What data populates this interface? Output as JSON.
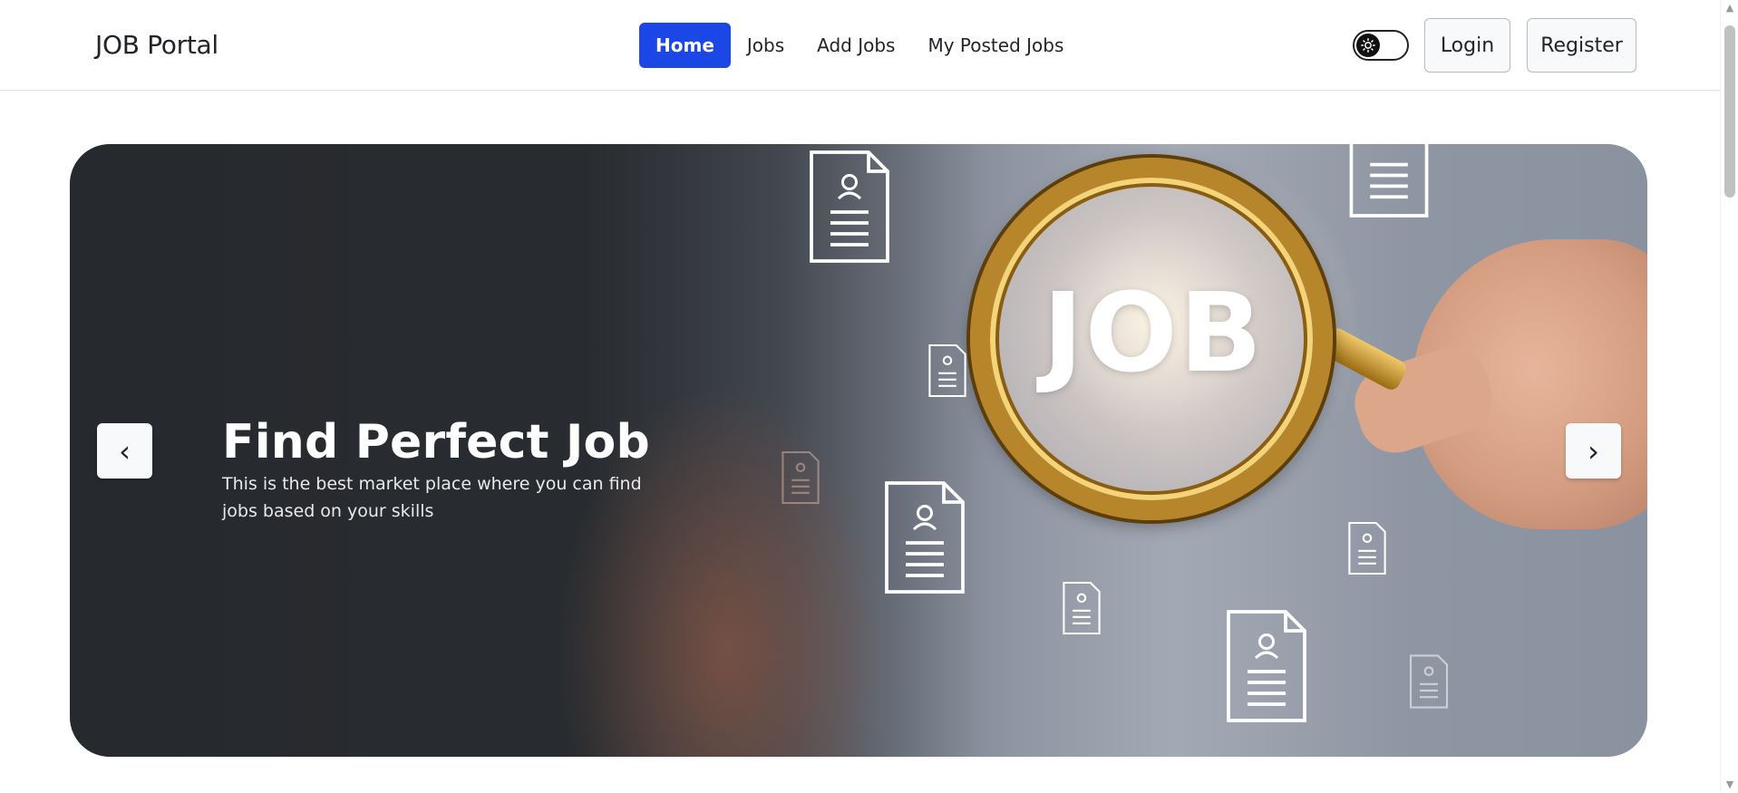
{
  "navbar": {
    "brand": "JOB Portal",
    "links": [
      {
        "label": "Home",
        "active": true
      },
      {
        "label": "Jobs",
        "active": false
      },
      {
        "label": "Add Jobs",
        "active": false
      },
      {
        "label": "My Posted Jobs",
        "active": false
      }
    ],
    "theme_toggle_icon": "sun-icon",
    "login_label": "Login",
    "register_label": "Register"
  },
  "hero": {
    "image_text": "JOB",
    "title": "Find Perfect Job",
    "subtitle": "This is the best market place where you can find jobs based on your skills",
    "prev_icon": "‹",
    "next_icon": "›"
  },
  "colors": {
    "accent": "#1a47e6",
    "page_bg": "#ffffff",
    "hero_dark": "#2a2d31"
  }
}
